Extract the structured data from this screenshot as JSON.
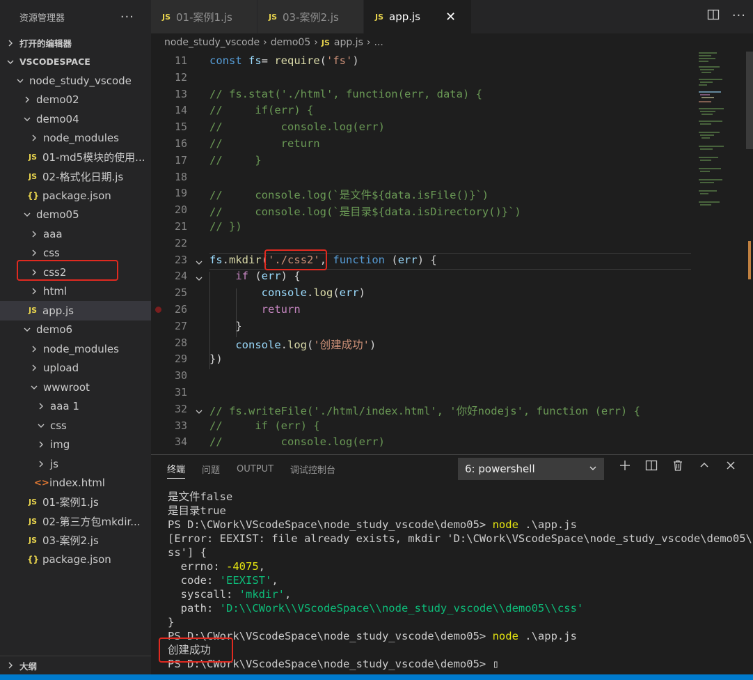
{
  "sidebar": {
    "title": "资源管理器",
    "more": "···",
    "open_editors": "打开的编辑器",
    "workspace": "VSCODESPACE",
    "outline": "大纲",
    "tree": [
      {
        "label": "node_study_vscode",
        "depth": 1,
        "type": "folder",
        "open": true
      },
      {
        "label": "demo02",
        "depth": 2,
        "type": "folder",
        "open": false
      },
      {
        "label": "demo04",
        "depth": 2,
        "type": "folder",
        "open": true
      },
      {
        "label": "node_modules",
        "depth": 3,
        "type": "folder",
        "open": false
      },
      {
        "label": "01-md5模块的使用...",
        "depth": 3,
        "type": "js"
      },
      {
        "label": "02-格式化日期.js",
        "depth": 3,
        "type": "js"
      },
      {
        "label": "package.json",
        "depth": 3,
        "type": "json"
      },
      {
        "label": "demo05",
        "depth": 2,
        "type": "folder",
        "open": true
      },
      {
        "label": "aaa",
        "depth": 3,
        "type": "folder",
        "open": false
      },
      {
        "label": "css",
        "depth": 3,
        "type": "folder",
        "open": false
      },
      {
        "label": "css2",
        "depth": 3,
        "type": "folder",
        "open": false
      },
      {
        "label": "html",
        "depth": 3,
        "type": "folder",
        "open": false
      },
      {
        "label": "app.js",
        "depth": 3,
        "type": "js",
        "selected": true
      },
      {
        "label": "demo6",
        "depth": 2,
        "type": "folder",
        "open": true
      },
      {
        "label": "node_modules",
        "depth": 3,
        "type": "folder",
        "open": false
      },
      {
        "label": "upload",
        "depth": 3,
        "type": "folder",
        "open": false
      },
      {
        "label": "wwwroot",
        "depth": 3,
        "type": "folder",
        "open": true
      },
      {
        "label": "aaa 1",
        "depth": 4,
        "type": "folder",
        "open": false
      },
      {
        "label": "css",
        "depth": 4,
        "type": "folder",
        "open": true
      },
      {
        "label": "img",
        "depth": 4,
        "type": "folder",
        "open": false
      },
      {
        "label": "js",
        "depth": 4,
        "type": "folder",
        "open": false
      },
      {
        "label": "index.html",
        "depth": 4,
        "type": "html"
      },
      {
        "label": "01-案例1.js",
        "depth": 3,
        "type": "js"
      },
      {
        "label": "02-第三方包mkdir...",
        "depth": 3,
        "type": "js"
      },
      {
        "label": "03-案例2.js",
        "depth": 3,
        "type": "js"
      },
      {
        "label": "package.json",
        "depth": 3,
        "type": "json"
      }
    ]
  },
  "tabs": [
    {
      "label": "01-案例1.js",
      "icon": "JS"
    },
    {
      "label": "03-案例2.js",
      "icon": "JS"
    },
    {
      "label": "app.js",
      "icon": "JS",
      "active": true,
      "close": "✕"
    }
  ],
  "breadcrumb": {
    "parts": [
      "node_study_vscode",
      "demo05"
    ],
    "file": "app.js",
    "tail": "..."
  },
  "editor": {
    "lines": [
      {
        "n": "11",
        "tokens": [
          [
            "kw",
            "const "
          ],
          [
            "var",
            "fs"
          ],
          [
            "",
            "= "
          ],
          [
            "fn",
            "require"
          ],
          [
            "",
            "("
          ],
          [
            "str",
            "'fs'"
          ],
          [
            "",
            ")"
          ]
        ]
      },
      {
        "n": "12",
        "tokens": []
      },
      {
        "n": "13",
        "tokens": [
          [
            "cm",
            "// fs.stat('./html', function(err, data) {"
          ]
        ]
      },
      {
        "n": "14",
        "tokens": [
          [
            "cm",
            "//     if(err) {"
          ]
        ]
      },
      {
        "n": "15",
        "tokens": [
          [
            "cm",
            "//         console.log(err)"
          ]
        ]
      },
      {
        "n": "16",
        "tokens": [
          [
            "cm",
            "//         return"
          ]
        ]
      },
      {
        "n": "17",
        "tokens": [
          [
            "cm",
            "//     }"
          ]
        ]
      },
      {
        "n": "18",
        "tokens": []
      },
      {
        "n": "19",
        "tokens": [
          [
            "cm",
            "//     console.log(`是文件${data.isFile()}`)"
          ]
        ]
      },
      {
        "n": "20",
        "tokens": [
          [
            "cm",
            "//     console.log(`是目录${data.isDirectory()}`)"
          ]
        ]
      },
      {
        "n": "21",
        "tokens": [
          [
            "cm",
            "// })"
          ]
        ]
      },
      {
        "n": "22",
        "tokens": []
      },
      {
        "n": "23",
        "tokens": [
          [
            "var",
            "fs"
          ],
          [
            "",
            "."
          ],
          [
            "fn",
            "mkdir"
          ],
          [
            "",
            "("
          ],
          [
            "str",
            "'./css2'"
          ],
          [
            "",
            ", "
          ],
          [
            "kw",
            "function "
          ],
          [
            "",
            "("
          ],
          [
            "var",
            "err"
          ],
          [
            "",
            ") {"
          ]
        ]
      },
      {
        "n": "24",
        "tokens": [
          [
            "",
            "    "
          ],
          [
            "ctl",
            "if "
          ],
          [
            "",
            "("
          ],
          [
            "var",
            "err"
          ],
          [
            "",
            ") {"
          ]
        ]
      },
      {
        "n": "25",
        "tokens": [
          [
            "",
            "        "
          ],
          [
            "var",
            "console"
          ],
          [
            "",
            "."
          ],
          [
            "fn",
            "log"
          ],
          [
            "",
            "("
          ],
          [
            "var",
            "err"
          ],
          [
            "",
            ")"
          ]
        ]
      },
      {
        "n": "26",
        "tokens": [
          [
            "",
            "        "
          ],
          [
            "ctl",
            "return"
          ]
        ]
      },
      {
        "n": "27",
        "tokens": [
          [
            "",
            "    }"
          ]
        ]
      },
      {
        "n": "28",
        "tokens": [
          [
            "",
            "    "
          ],
          [
            "var",
            "console"
          ],
          [
            "",
            "."
          ],
          [
            "fn",
            "log"
          ],
          [
            "",
            "("
          ],
          [
            "str",
            "'创建成功'"
          ],
          [
            "",
            ")"
          ]
        ]
      },
      {
        "n": "29",
        "tokens": [
          [
            "",
            "})"
          ]
        ]
      },
      {
        "n": "30",
        "tokens": []
      },
      {
        "n": "31",
        "tokens": []
      },
      {
        "n": "32",
        "tokens": [
          [
            "cm",
            "// fs.writeFile('./html/index.html', '你好nodejs', function (err) {"
          ]
        ]
      },
      {
        "n": "33",
        "tokens": [
          [
            "cm",
            "//     if (err) {"
          ]
        ]
      },
      {
        "n": "34",
        "tokens": [
          [
            "cm",
            "//         console.log(err)"
          ]
        ]
      }
    ]
  },
  "panel": {
    "tabs": [
      "终端",
      "问题",
      "OUTPUT",
      "调试控制台"
    ],
    "terminal_select": "6: powershell",
    "terminal": [
      [
        [
          "",
          "是文件false"
        ]
      ],
      [
        [
          "",
          "是目录true"
        ]
      ],
      [
        [
          "",
          "PS D:\\CWork\\VScodeSpace\\node_study_vscode\\demo05> "
        ],
        [
          "y",
          "node"
        ],
        [
          "",
          " .\\app.js"
        ]
      ],
      [
        [
          "",
          "[Error: EEXIST: file already exists, mkdir 'D:\\CWork\\VScodeSpace\\node_study_vscode\\demo05\\c"
        ]
      ],
      [
        [
          "",
          "ss'] {"
        ]
      ],
      [
        [
          "",
          "  errno: "
        ],
        [
          "y",
          "-4075"
        ],
        [
          "",
          ","
        ]
      ],
      [
        [
          "",
          "  code: "
        ],
        [
          "g",
          "'EEXIST'"
        ],
        [
          "",
          ","
        ]
      ],
      [
        [
          "",
          "  syscall: "
        ],
        [
          "g",
          "'mkdir'"
        ],
        [
          "",
          ","
        ]
      ],
      [
        [
          "",
          "  path: "
        ],
        [
          "g",
          "'D:\\\\CWork\\\\VScodeSpace\\\\node_study_vscode\\\\demo05\\\\css'"
        ]
      ],
      [
        [
          "",
          "}"
        ]
      ],
      [
        [
          "",
          "PS D:\\CWork\\VScodeSpace\\node_study_vscode\\demo05> "
        ],
        [
          "y",
          "node"
        ],
        [
          "",
          " .\\app.js"
        ]
      ],
      [
        [
          "",
          "创建成功"
        ]
      ],
      [
        [
          "",
          "PS D:\\CWork\\VScodeSpace\\node_study_vscode\\demo05> "
        ],
        [
          "",
          "▯"
        ]
      ]
    ]
  },
  "colors": {
    "accent": "#007acc",
    "highlight_box": "#e02a20"
  }
}
